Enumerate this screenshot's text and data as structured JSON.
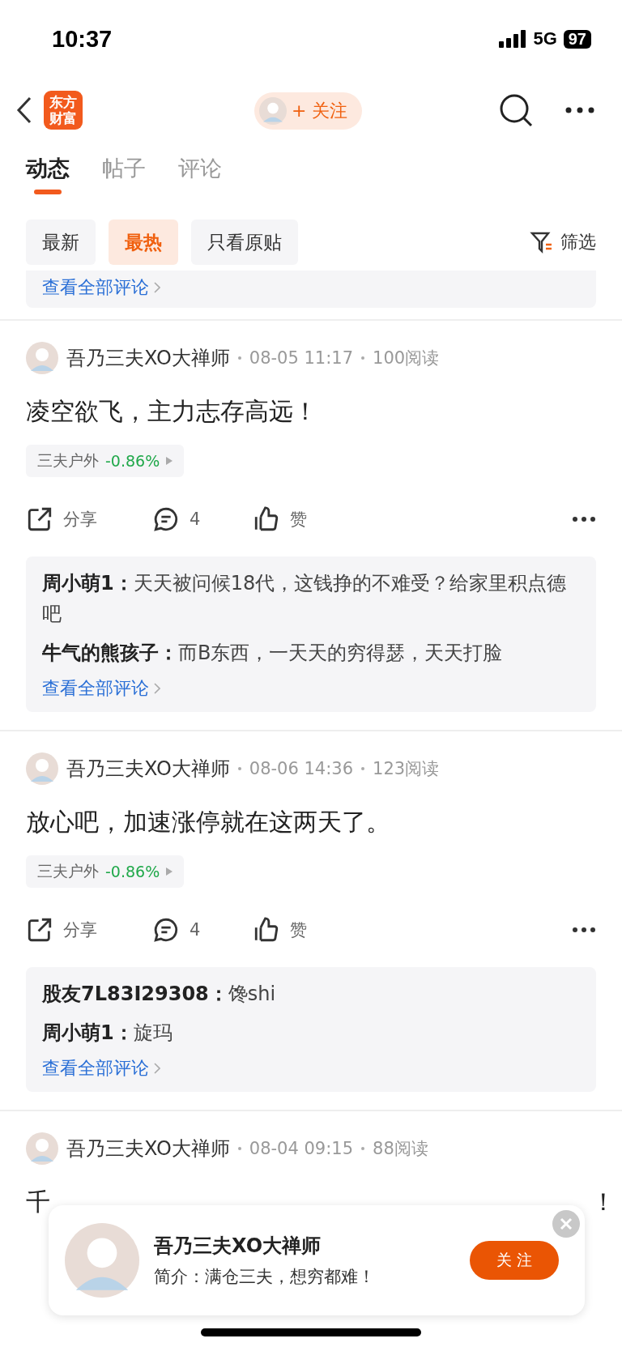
{
  "status_bar": {
    "time": "10:37",
    "network": "5G",
    "battery": "97"
  },
  "header": {
    "logo": [
      "东方",
      "财富"
    ],
    "follow": "+ 关注"
  },
  "tabs": [
    {
      "label": "动态",
      "selected": true
    },
    {
      "label": "帖子",
      "selected": false
    },
    {
      "label": "评论",
      "selected": false
    }
  ],
  "filters": [
    {
      "label": "最新",
      "selected": false
    },
    {
      "label": "最热",
      "selected": true
    },
    {
      "label": "只看原贴",
      "selected": false
    }
  ],
  "filter_button": "筛选",
  "previous_card": {
    "link": "查看全部评论"
  },
  "posts": [
    {
      "author": "吾乃三夫XO大禅师",
      "time": "08-05 11:17",
      "reads": "100阅读",
      "body": "凌空欲飞，主力志存高远！",
      "stock": {
        "name": "三夫户外",
        "change": "-0.86%"
      },
      "share": "分享",
      "comments_count": "4",
      "like": "赞",
      "comments": [
        {
          "user": "周小萌1：",
          "text": "天天被问候18代，这钱挣的不难受？给家里积点德吧"
        },
        {
          "user": "牛气的熊孩子：",
          "text": "而B东西，一天天的穷得瑟，天天打脸"
        }
      ],
      "view_all": "查看全部评论"
    },
    {
      "author": "吾乃三夫XO大禅师",
      "time": "08-06 14:36",
      "reads": "123阅读",
      "body": "放心吧，加速涨停就在这两天了。",
      "stock": {
        "name": "三夫户外",
        "change": "-0.86%"
      },
      "share": "分享",
      "comments_count": "4",
      "like": "赞",
      "comments": [
        {
          "user": "股友7L83I29308：",
          "text": "馋shi"
        },
        {
          "user": "周小萌1：",
          "text": "旋玛"
        }
      ],
      "view_all": "查看全部评论"
    }
  ],
  "partial_post": {
    "author": "吾乃三夫XO大禅师",
    "time": "08-04 09:15",
    "reads": "88阅读",
    "body_start": "千",
    "body_end": "！"
  },
  "popup": {
    "name": "吾乃三夫XO大禅师",
    "intro": "简介：满仓三夫，想穷都难！",
    "follow": "关 注"
  }
}
